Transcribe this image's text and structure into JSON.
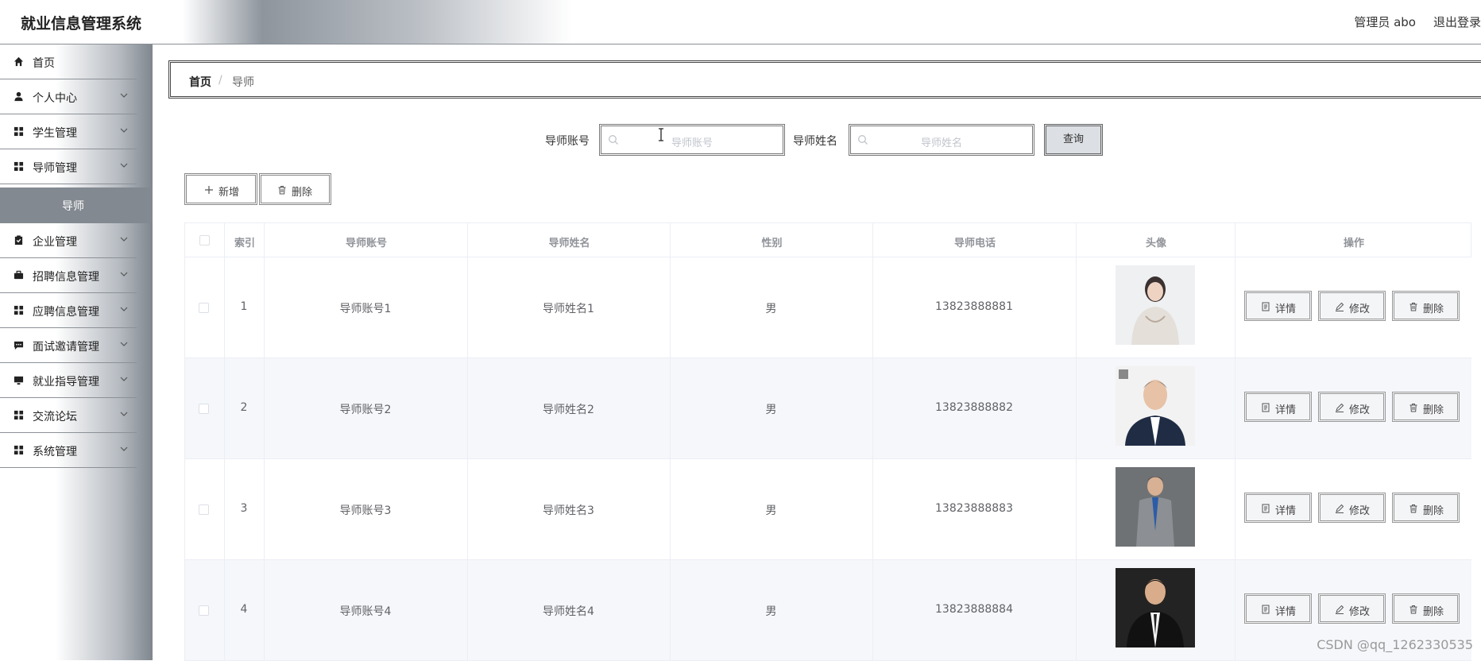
{
  "header": {
    "title": "就业信息管理系统",
    "user": "管理员 abo",
    "logout": "退出登录"
  },
  "sidebar": {
    "items": [
      {
        "label": "首页",
        "icon": "home-icon"
      },
      {
        "label": "个人中心",
        "icon": "user-icon"
      },
      {
        "label": "学生管理",
        "icon": "grid-icon"
      },
      {
        "label": "导师管理",
        "icon": "grid-icon"
      },
      {
        "label": "企业管理",
        "icon": "clipboard-icon"
      },
      {
        "label": "招聘信息管理",
        "icon": "briefcase-icon"
      },
      {
        "label": "应聘信息管理",
        "icon": "grid-icon"
      },
      {
        "label": "面试邀请管理",
        "icon": "chat-icon"
      },
      {
        "label": "就业指导管理",
        "icon": "monitor-icon"
      },
      {
        "label": "交流论坛",
        "icon": "grid-icon"
      },
      {
        "label": "系统管理",
        "icon": "grid-icon"
      }
    ],
    "active_sub": "导师"
  },
  "breadcrumb": {
    "home": "首页",
    "separator": "/",
    "current": "导师"
  },
  "search": {
    "account_label": "导师账号",
    "account_placeholder": "导师账号",
    "name_label": "导师姓名",
    "name_placeholder": "导师姓名",
    "query_button": "查询"
  },
  "actions": {
    "add": "新增",
    "delete": "删除"
  },
  "table": {
    "headers": [
      "索引",
      "导师账号",
      "导师姓名",
      "性别",
      "导师电话",
      "头像",
      "操作"
    ],
    "rows": [
      {
        "index": "1",
        "account": "导师账号1",
        "name": "导师姓名1",
        "gender": "男",
        "phone": "13823888881"
      },
      {
        "index": "2",
        "account": "导师账号2",
        "name": "导师姓名2",
        "gender": "男",
        "phone": "13823888882"
      },
      {
        "index": "3",
        "account": "导师账号3",
        "name": "导师姓名3",
        "gender": "男",
        "phone": "13823888883"
      },
      {
        "index": "4",
        "account": "导师账号4",
        "name": "导师姓名4",
        "gender": "男",
        "phone": "13823888884"
      }
    ],
    "row_actions": {
      "detail": "详情",
      "edit": "修改",
      "delete": "删除"
    }
  },
  "watermark": "CSDN @qq_1262330535",
  "colors": {
    "sidebar_active": "#828990",
    "row_alt": "#f5f7fa",
    "border": "#ebeef5",
    "header_text": "#909399"
  }
}
